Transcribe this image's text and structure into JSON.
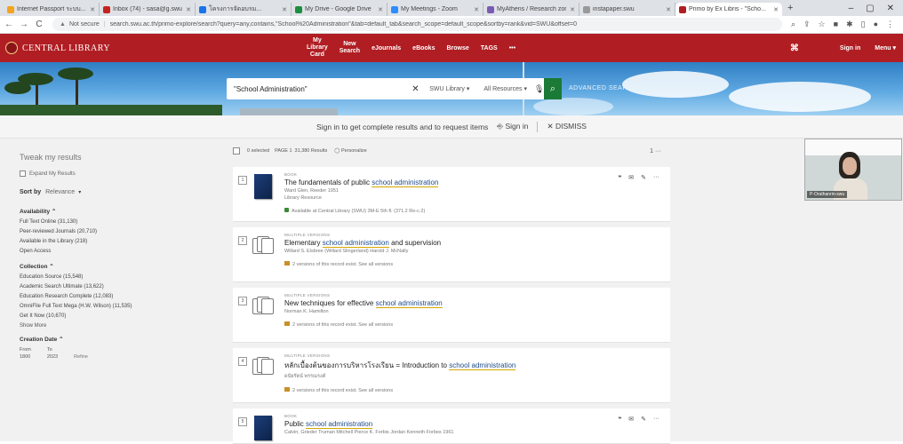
{
  "browser": {
    "tabs": [
      {
        "label": "Internet Passport ระบบ...",
        "color": "#f3a31c"
      },
      {
        "label": "Inbox (74) - sasa@g.swu...",
        "color": "#c5221f"
      },
      {
        "label": "โครงการจัดอบรม...",
        "color": "#1a73e8"
      },
      {
        "label": "My Drive - Google Drive",
        "color": "#1e8e3e"
      },
      {
        "label": "My Meetings - Zoom",
        "color": "#2d8cff"
      },
      {
        "label": "MyAthens / Research zone",
        "color": "#7a5bb4"
      },
      {
        "label": "instapaper.swu",
        "color": "#999999"
      },
      {
        "label": "Primo by Ex Libris - \"Scho...",
        "color": "#b01e23",
        "active": true
      }
    ],
    "url": "search.swu.ac.th/primo-explore/search?query=any,contains,\"School%20Administration\"&tab=default_tab&search_scope=default_scope&sortby=rank&vid=SWU&offset=0",
    "not_secure": "Not secure",
    "window_controls": [
      "–",
      "▢",
      "✕"
    ]
  },
  "topnav": {
    "brand": "CENTRAL LIBRARY",
    "links": [
      {
        "line1": "My",
        "line2": "Library",
        "line3": "Card"
      },
      {
        "line1": "New",
        "line2": "Search"
      },
      {
        "label": "eJournals"
      },
      {
        "label": "eBooks"
      },
      {
        "label": "Browse"
      },
      {
        "label": "TAGS"
      },
      {
        "label": "•••"
      }
    ],
    "signin": "Sign in",
    "menu": "Menu ▾"
  },
  "search": {
    "query": "\"School Administration\"",
    "scope": "SWU Library",
    "resources": "All Resources",
    "advanced": "ADVANCED SEARCH"
  },
  "signin_bar": {
    "message": "Sign in to get complete results and to request items",
    "signin": "Sign in",
    "dismiss": "DISMISS"
  },
  "sidebar": {
    "title": "Tweak my results",
    "expand": "Expand My Results",
    "sort_label": "Sort by",
    "sort_value": "Relevance",
    "availability": {
      "heading": "Availability",
      "items": [
        "Full Text Online (31,130)",
        "Peer-reviewed Journals (20,710)",
        "Available in the Library (218)",
        "Open Access"
      ]
    },
    "collection": {
      "heading": "Collection",
      "items": [
        "Education Source (15,548)",
        "Academic Search Ultimate (13,622)",
        "Education Research Complete (12,083)",
        "OmniFile Full Text Mega (H.W. Wilson) (11,535)",
        "Get It Now (10,670)"
      ],
      "show_more": "Show More"
    },
    "creation_date": {
      "heading": "Creation Date",
      "from_label": "From",
      "to_label": "To",
      "from": "1800",
      "to": "2023",
      "refine": "Refine"
    }
  },
  "results_toolbar": {
    "selected": "0 selected",
    "page": "PAGE 1",
    "count": "31,380 Results",
    "personalize": "Personalize",
    "pages": "1"
  },
  "results": [
    {
      "num": "1",
      "kind": "book",
      "type": "BOOK",
      "title_pre": "The fundamentals of public ",
      "title_hl": "school administration",
      "title_post": "",
      "meta1": "Ward Glen, Reeder 1951",
      "meta2": "Library Resource",
      "avail": "Available at Central Library (SWU) 3M-E 5th fl. (371.2 Re-c.2)"
    },
    {
      "num": "2",
      "kind": "multi",
      "type": "MULTIPLE VERSIONS",
      "title_pre": "Elementary ",
      "title_hl": "school administration",
      "title_post": " and supervision",
      "meta1": "Willard S. Elsbree (Willard Slingerland) Harold J. McNally",
      "meta2": "",
      "avail": "2 versions of this record exist. See all versions"
    },
    {
      "num": "3",
      "kind": "multi",
      "type": "MULTIPLE VERSIONS",
      "title_pre": "New techniques for effective ",
      "title_hl": "school administration",
      "title_post": "",
      "meta1": "Norman K. Hamilton",
      "meta2": "",
      "avail": "2 versions of this record exist. See all versions"
    },
    {
      "num": "4",
      "kind": "multi",
      "type": "MULTIPLE VERSIONS",
      "title_pre": "หลักเบื้องต้นของการบริหารโรงเรียน = Introduction to ",
      "title_hl": "school administration",
      "title_post": "",
      "meta1": "ดนัยรัตน์ พรรณรงค์",
      "meta2": "",
      "avail": "2 versions of this record exist. See all versions"
    },
    {
      "num": "5",
      "kind": "book",
      "type": "BOOK",
      "title_pre": "Public ",
      "title_hl": "school administration",
      "title_post": "",
      "meta1": "Calvin, Grieder Truman Mitchell Pierce K. Forbis Jordan Kenneth Forbes 1961",
      "meta2": "",
      "avail": ""
    }
  ],
  "video": {
    "name": "P-Orathanrin-swu"
  }
}
